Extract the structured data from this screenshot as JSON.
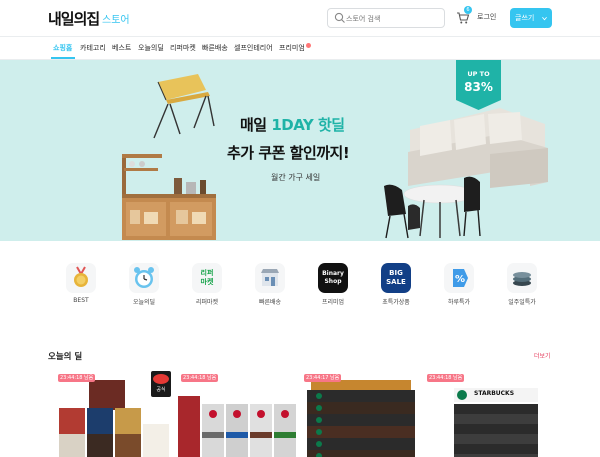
{
  "header": {
    "logo": "내일의집",
    "store": "스토어",
    "search_placeholder": "스토어 검색",
    "cart_count": "6",
    "login": "로그인",
    "write_button": "글쓰기"
  },
  "nav": {
    "items": [
      {
        "label": "쇼핑홈",
        "active": true
      },
      {
        "label": "카테고리"
      },
      {
        "label": "베스트"
      },
      {
        "label": "오늘의딜"
      },
      {
        "label": "리퍼마켓"
      },
      {
        "label": "빠른배송"
      },
      {
        "label": "셀프인테리어"
      },
      {
        "label": "프리미엄"
      }
    ]
  },
  "banner": {
    "line1_prefix": "매일 ",
    "line1_highlight": "1DAY 핫딜",
    "line2": "추가 쿠폰 할인까지!",
    "line3": "월간 가구 세일",
    "badge_top": "UP TO",
    "badge_value": "83%",
    "accent": "#1fb3a7"
  },
  "categories": [
    {
      "label": "BEST",
      "icon": "trophy-medal-icon"
    },
    {
      "label": "오늘의딜",
      "icon": "alarm-clock-icon"
    },
    {
      "label": "리퍼마켓",
      "icon": "refurb-market-icon",
      "tile_text": "리퍼\n마켓"
    },
    {
      "label": "빠른배송",
      "icon": "store-building-icon"
    },
    {
      "label": "프리미엄",
      "icon": "binary-shop-icon",
      "tile_text": "Binary Shop"
    },
    {
      "label": "초특가상품",
      "icon": "big-sale-icon",
      "tile_text": "BIG SALE"
    },
    {
      "label": "하루특가",
      "icon": "percent-tag-icon"
    },
    {
      "label": "일주일특가",
      "icon": "stacked-items-icon"
    }
  ],
  "deals": {
    "title": "오늘의 딜",
    "more": "더보기",
    "cards": [
      {
        "timer": "23:44:18 남음"
      },
      {
        "timer": "23:44:18 남음",
        "badge": "공식"
      },
      {
        "timer": "23:44:17 남음"
      },
      {
        "timer": "23:44:18 남음",
        "brand": "STARBUCKS"
      }
    ]
  },
  "colors": {
    "brand": "#35c5f0",
    "deal_red": "#f77687"
  }
}
